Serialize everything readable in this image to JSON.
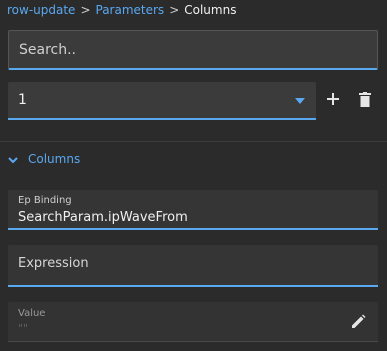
{
  "breadcrumb": {
    "items": [
      "row-update",
      "Parameters",
      "Columns"
    ],
    "separator": ">"
  },
  "search": {
    "placeholder": "Search.."
  },
  "selector": {
    "value": "1"
  },
  "section": {
    "title": "Columns"
  },
  "fields": {
    "ep_binding": {
      "label": "Ep Binding",
      "value": "SearchParam.ipWaveFrom"
    },
    "expression": {
      "placeholder": "Expression"
    },
    "value": {
      "label": "Value",
      "value": "\"\""
    }
  },
  "icons": {
    "add": "plus-icon",
    "delete": "trash-icon",
    "collapse": "chevron-down-icon",
    "edit": "pencil-icon"
  },
  "colors": {
    "background": "#2b2b2b",
    "accent": "#5aa8f0",
    "field": "#3b3b3b",
    "text": "#e6e6e6"
  }
}
